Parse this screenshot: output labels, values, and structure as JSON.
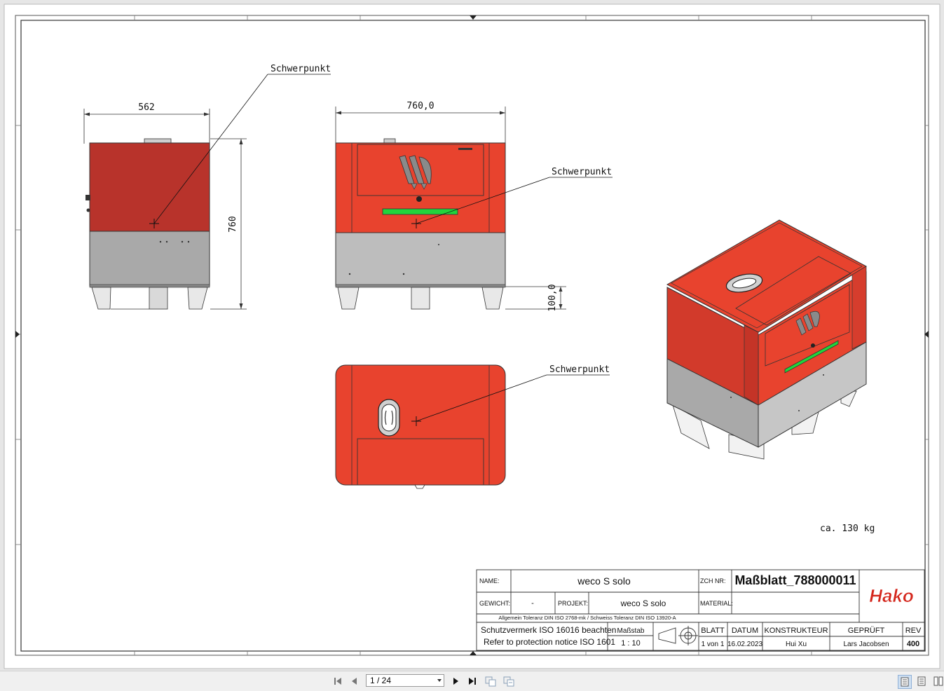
{
  "drawing": {
    "views": {
      "side": {
        "width_dim": "562",
        "height_dim": "760",
        "cog_label": "Schwerpunkt"
      },
      "front": {
        "width_dim": "760,0",
        "foot_dim": "100,0",
        "cog_label": "Schwerpunkt"
      },
      "top": {
        "cog_label": "Schwerpunkt"
      }
    },
    "weight_note": "ca. 130 kg",
    "colors": {
      "housing_red": "#e8432e",
      "side_red": "#b8332b",
      "base_gray": "#a9a9a9",
      "led_green": "#22d43c"
    }
  },
  "title_block": {
    "name_label": "NAME:",
    "name_value": "weco  S solo",
    "zchnr_label": "ZCH NR:",
    "zchnr_value": "Maßblatt_788000011",
    "gewicht_label": "GEWICHT:",
    "gewicht_value": "-",
    "projekt_label": "PROJEKT:",
    "projekt_value": "weco  S solo",
    "material_label": "MATERIAL:",
    "material_value": "",
    "tolerance_note": "Allgemein Toleranz DIN ISO 2768-mk / Schweiss Toleranz DIN ISO 13920-A",
    "protection_de": "Schutzvermerk  ISO 16016 beachten",
    "protection_en": "Refer to protection notice ISO 1601",
    "massstab_label": "Maßstab",
    "massstab_value": "1 : 10",
    "blatt_label": "BLATT",
    "blatt_value": "1 von 1",
    "datum_label": "DATUM",
    "datum_value": "16.02.2023",
    "konstrukteur_label": "KONSTRUKTEUR",
    "konstrukteur_value": "Hui Xu",
    "geprueft_label": "GEPRÜFT",
    "geprueft_value": "Lars Jacobsen",
    "rev_label": "REV",
    "rev_value": "400",
    "logo": "Hako",
    "logo_color": "#d4261c"
  },
  "toolbar": {
    "page_indicator": "1 / 24",
    "icons": [
      "first-page-icon",
      "prev-page-icon",
      "next-page-icon",
      "last-page-icon",
      "two-page-icon",
      "continuous-icon",
      "single-page-view-icon",
      "facing-view-icon",
      "continuous-view-icon"
    ]
  }
}
